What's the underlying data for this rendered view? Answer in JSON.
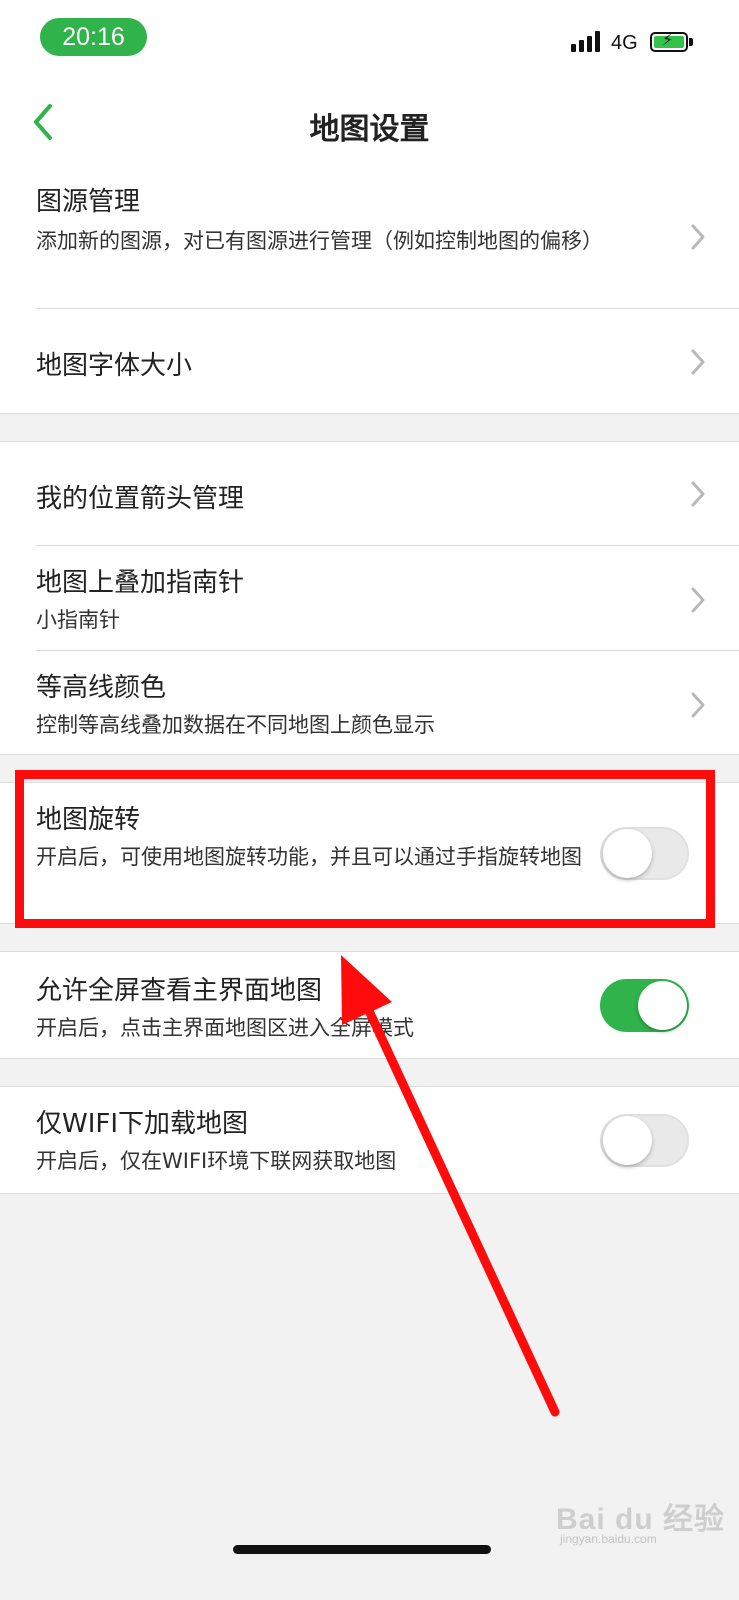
{
  "status_bar": {
    "time": "20:16",
    "network": "4G",
    "accent_color": "#2fb34a"
  },
  "nav": {
    "title": "地图设置",
    "back_icon": "chevron-left-icon"
  },
  "groups": [
    {
      "items": [
        {
          "title": "图源管理",
          "desc": "添加新的图源，对已有图源进行管理（例如控制地图的偏移）",
          "control": "chevron"
        },
        {
          "title": "地图字体大小",
          "control": "chevron"
        }
      ]
    },
    {
      "items": [
        {
          "title": "我的位置箭头管理",
          "control": "chevron"
        },
        {
          "title": "地图上叠加指南针",
          "desc": "小指南针",
          "control": "chevron"
        },
        {
          "title": "等高线颜色",
          "desc": "控制等高线叠加数据在不同地图上颜色显示",
          "control": "chevron"
        }
      ]
    },
    {
      "items": [
        {
          "title": "地图旋转",
          "desc": "开启后，可使用地图旋转功能，并且可以通过手指旋转地图",
          "control": "toggle",
          "on": false
        }
      ]
    },
    {
      "items": [
        {
          "title": "允许全屏查看主界面地图",
          "desc": "开启后，点击主界面地图区进入全屏模式",
          "control": "toggle",
          "on": true
        }
      ]
    },
    {
      "items": [
        {
          "title": "仅WIFI下加载地图",
          "desc": "开启后，仅在WIFI环境下联网获取地图",
          "control": "toggle",
          "on": false
        }
      ]
    }
  ],
  "annotation": {
    "color": "#ff0b0b"
  },
  "watermark": {
    "text": "Bai du 经验",
    "sub": "jingyan.baidu.com"
  }
}
